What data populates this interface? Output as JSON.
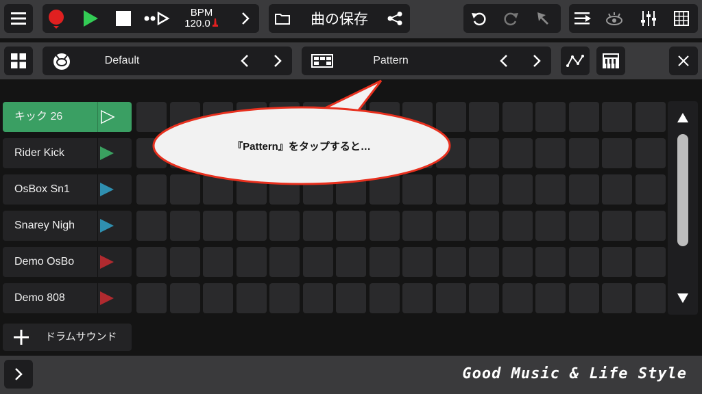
{
  "transport": {
    "bpm_label": "BPM",
    "bpm_value": "120.0",
    "song_save": "曲の保存"
  },
  "kit_selector": {
    "value": "Default"
  },
  "pattern_selector": {
    "value": "Pattern"
  },
  "tracks": [
    {
      "label": "キック 26",
      "active": true,
      "color": "#3aa060"
    },
    {
      "label": "Rider Kick",
      "active": false,
      "color": "#3aa060"
    },
    {
      "label": "OsBox Sn1",
      "active": false,
      "color": "#2f8fb0"
    },
    {
      "label": "Snarey Nigh",
      "active": false,
      "color": "#2f8fb0"
    },
    {
      "label": "Demo OsBo",
      "active": false,
      "color": "#b02a2f"
    },
    {
      "label": "Demo 808",
      "active": false,
      "color": "#b02a2f"
    }
  ],
  "add_drum_sound": "ドラムサウンド",
  "callout": {
    "text": "『Pattern』をタップすると…"
  },
  "branding": "Good Music & Life Style",
  "colors": {
    "accent_green": "#3a9f63",
    "record_red": "#e02020",
    "play_green": "#33cc55"
  }
}
